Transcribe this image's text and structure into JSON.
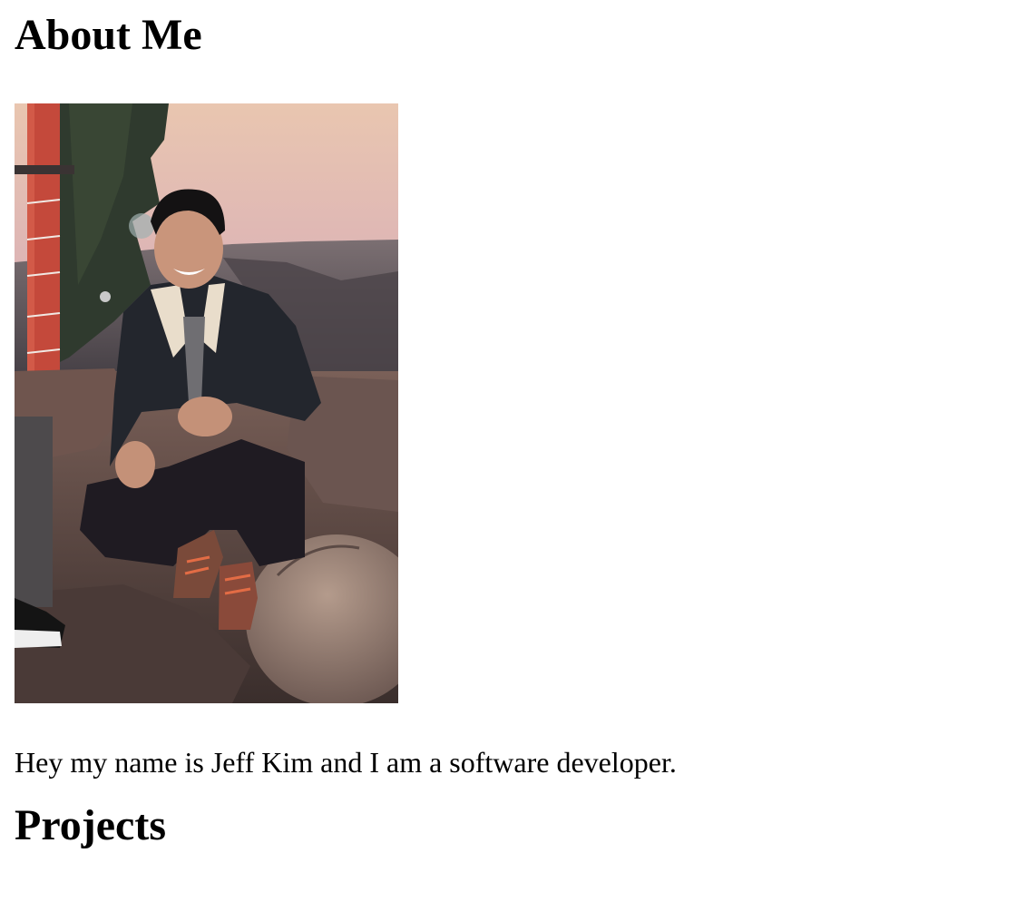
{
  "about": {
    "heading": "About Me",
    "photo_alt": "Photo of Jeff Kim crouching on rocks at sunset",
    "intro": "Hey my name is Jeff Kim and I am a software developer."
  },
  "projects": {
    "heading": "Projects"
  },
  "colors": {
    "text": "#000000",
    "background": "#ffffff"
  }
}
